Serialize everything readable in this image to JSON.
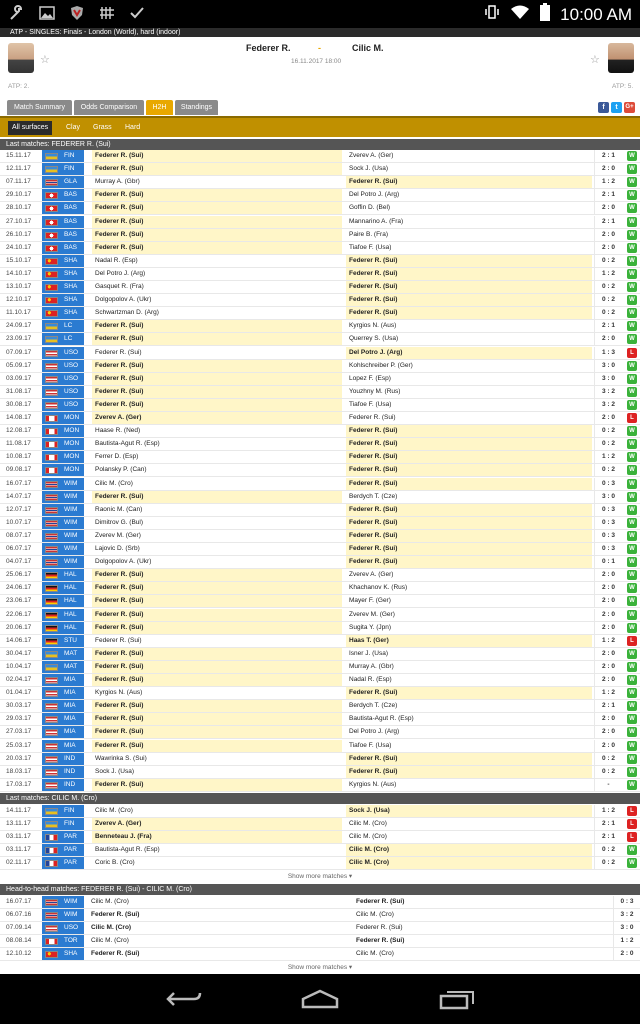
{
  "status_bar": {
    "time": "10:00 AM",
    "icons": [
      "wrench-icon",
      "image-icon",
      "shield-icon",
      "grid-icon",
      "check-icon"
    ]
  },
  "competition": "ATP - SINGLES: Finals - London (World), hard (indoor)",
  "match": {
    "home": "Federer R.",
    "away": "Cilic M.",
    "separator": "-",
    "datetime": "16.11.2017 18:00",
    "home_rank": "ATP: 2.",
    "away_rank": "ATP: 5."
  },
  "tabs": [
    "Match Summary",
    "Odds Comparison",
    "H2H",
    "Standings"
  ],
  "active_tab": "H2H",
  "social": [
    "f",
    "t",
    "G+"
  ],
  "surfaces": [
    "All surfaces",
    "Clay",
    "Grass",
    "Hard"
  ],
  "sections": {
    "federer_title": "Last matches: FEDERER R. (Sui)",
    "cilic_title": "Last matches: CILIC M. (Cro)",
    "h2h_title": "Head-to-head matches: FEDERER R. (Sui) - CILIC M. (Cro)",
    "show_more": "Show more matches"
  },
  "colors": {
    "accent": "#e8a800",
    "win": "#3ab23a",
    "loss": "#dd2222",
    "tournament": "#2b7bd1"
  },
  "federer_matches": [
    {
      "date": "15.11.17",
      "t": "FIN",
      "flag": "wld",
      "home": "Federer R. (Sui)",
      "away": "Zverev A. (Ger)",
      "score": "2 : 1",
      "res": "W",
      "f": "h"
    },
    {
      "date": "12.11.17",
      "t": "FIN",
      "flag": "wld",
      "home": "Federer R. (Sui)",
      "away": "Sock J. (Usa)",
      "score": "2 : 0",
      "res": "W",
      "f": "h"
    },
    {
      "date": "07.11.17",
      "t": "GLA",
      "flag": "gbr",
      "home": "Murray A. (Gbr)",
      "away": "Federer R. (Sui)",
      "score": "1 : 2",
      "res": "W",
      "f": "a"
    },
    {
      "date": "29.10.17",
      "t": "BAS",
      "flag": "sui",
      "home": "Federer R. (Sui)",
      "away": "Del Potro J. (Arg)",
      "score": "2 : 1",
      "res": "W",
      "f": "h"
    },
    {
      "date": "28.10.17",
      "t": "BAS",
      "flag": "sui",
      "home": "Federer R. (Sui)",
      "away": "Goffin D. (Bel)",
      "score": "2 : 0",
      "res": "W",
      "f": "h"
    },
    {
      "date": "27.10.17",
      "t": "BAS",
      "flag": "sui",
      "home": "Federer R. (Sui)",
      "away": "Mannarino A. (Fra)",
      "score": "2 : 1",
      "res": "W",
      "f": "h"
    },
    {
      "date": "26.10.17",
      "t": "BAS",
      "flag": "sui",
      "home": "Federer R. (Sui)",
      "away": "Paire B. (Fra)",
      "score": "2 : 0",
      "res": "W",
      "f": "h"
    },
    {
      "date": "24.10.17",
      "t": "BAS",
      "flag": "sui",
      "home": "Federer R. (Sui)",
      "away": "Tiafoe F. (Usa)",
      "score": "2 : 0",
      "res": "W",
      "f": "h"
    },
    {
      "date": "15.10.17",
      "t": "SHA",
      "flag": "chn",
      "home": "Nadal R. (Esp)",
      "away": "Federer R. (Sui)",
      "score": "0 : 2",
      "res": "W",
      "f": "a"
    },
    {
      "date": "14.10.17",
      "t": "SHA",
      "flag": "chn",
      "home": "Del Potro J. (Arg)",
      "away": "Federer R. (Sui)",
      "score": "1 : 2",
      "res": "W",
      "f": "a"
    },
    {
      "date": "13.10.17",
      "t": "SHA",
      "flag": "chn",
      "home": "Gasquet R. (Fra)",
      "away": "Federer R. (Sui)",
      "score": "0 : 2",
      "res": "W",
      "f": "a"
    },
    {
      "date": "12.10.17",
      "t": "SHA",
      "flag": "chn",
      "home": "Dolgopolov A. (Ukr)",
      "away": "Federer R. (Sui)",
      "score": "0 : 2",
      "res": "W",
      "f": "a"
    },
    {
      "date": "11.10.17",
      "t": "SHA",
      "flag": "chn",
      "home": "Schwartzman D. (Arg)",
      "away": "Federer R. (Sui)",
      "score": "0 : 2",
      "res": "W",
      "f": "a"
    },
    {
      "date": "24.09.17",
      "t": "LC",
      "flag": "wld",
      "home": "Federer R. (Sui)",
      "away": "Kyrgios N. (Aus)",
      "score": "2 : 1",
      "res": "W",
      "f": "h"
    },
    {
      "date": "23.09.17",
      "t": "LC",
      "flag": "wld",
      "home": "Federer R. (Sui)",
      "away": "Querrey S. (Usa)",
      "score": "2 : 0",
      "res": "W",
      "f": "h"
    },
    {
      "date": "07.09.17",
      "t": "USO",
      "flag": "usa",
      "home": "Federer R. (Sui)",
      "away": "Del Potro J. (Arg)",
      "score": "1 : 3",
      "res": "L",
      "f": "a"
    },
    {
      "date": "05.09.17",
      "t": "USO",
      "flag": "usa",
      "home": "Federer R. (Sui)",
      "away": "Kohlschreiber P. (Ger)",
      "score": "3 : 0",
      "res": "W",
      "f": "h"
    },
    {
      "date": "03.09.17",
      "t": "USO",
      "flag": "usa",
      "home": "Federer R. (Sui)",
      "away": "Lopez F. (Esp)",
      "score": "3 : 0",
      "res": "W",
      "f": "h"
    },
    {
      "date": "31.08.17",
      "t": "USO",
      "flag": "usa",
      "home": "Federer R. (Sui)",
      "away": "Youzhny M. (Rus)",
      "score": "3 : 2",
      "res": "W",
      "f": "h"
    },
    {
      "date": "30.08.17",
      "t": "USO",
      "flag": "usa",
      "home": "Federer R. (Sui)",
      "away": "Tiafoe F. (Usa)",
      "score": "3 : 2",
      "res": "W",
      "f": "h"
    },
    {
      "date": "14.08.17",
      "t": "MON",
      "flag": "can",
      "home": "Zverev A. (Ger)",
      "away": "Federer R. (Sui)",
      "score": "2 : 0",
      "res": "L",
      "f": "h"
    },
    {
      "date": "12.08.17",
      "t": "MON",
      "flag": "can",
      "home": "Haase R. (Ned)",
      "away": "Federer R. (Sui)",
      "score": "0 : 2",
      "res": "W",
      "f": "a"
    },
    {
      "date": "11.08.17",
      "t": "MON",
      "flag": "can",
      "home": "Bautista-Agut R. (Esp)",
      "away": "Federer R. (Sui)",
      "score": "0 : 2",
      "res": "W",
      "f": "a"
    },
    {
      "date": "10.08.17",
      "t": "MON",
      "flag": "can",
      "home": "Ferrer D. (Esp)",
      "away": "Federer R. (Sui)",
      "score": "1 : 2",
      "res": "W",
      "f": "a"
    },
    {
      "date": "09.08.17",
      "t": "MON",
      "flag": "can",
      "home": "Polansky P. (Can)",
      "away": "Federer R. (Sui)",
      "score": "0 : 2",
      "res": "W",
      "f": "a"
    },
    {
      "date": "16.07.17",
      "t": "WIM",
      "flag": "gbr",
      "home": "Cilic M. (Cro)",
      "away": "Federer R. (Sui)",
      "score": "0 : 3",
      "res": "W",
      "f": "a"
    },
    {
      "date": "14.07.17",
      "t": "WIM",
      "flag": "gbr",
      "home": "Federer R. (Sui)",
      "away": "Berdych T. (Cze)",
      "score": "3 : 0",
      "res": "W",
      "f": "h"
    },
    {
      "date": "12.07.17",
      "t": "WIM",
      "flag": "gbr",
      "home": "Raonic M. (Can)",
      "away": "Federer R. (Sui)",
      "score": "0 : 3",
      "res": "W",
      "f": "a"
    },
    {
      "date": "10.07.17",
      "t": "WIM",
      "flag": "gbr",
      "home": "Dimitrov G. (Bul)",
      "away": "Federer R. (Sui)",
      "score": "0 : 3",
      "res": "W",
      "f": "a"
    },
    {
      "date": "08.07.17",
      "t": "WIM",
      "flag": "gbr",
      "home": "Zverev M. (Ger)",
      "away": "Federer R. (Sui)",
      "score": "0 : 3",
      "res": "W",
      "f": "a"
    },
    {
      "date": "06.07.17",
      "t": "WIM",
      "flag": "gbr",
      "home": "Lajovic D. (Srb)",
      "away": "Federer R. (Sui)",
      "score": "0 : 3",
      "res": "W",
      "f": "a"
    },
    {
      "date": "04.07.17",
      "t": "WIM",
      "flag": "gbr",
      "home": "Dolgopolov A. (Ukr)",
      "away": "Federer R. (Sui)",
      "score": "0 : 1",
      "res": "W",
      "f": "a"
    },
    {
      "date": "25.06.17",
      "t": "HAL",
      "flag": "ger",
      "home": "Federer R. (Sui)",
      "away": "Zverev A. (Ger)",
      "score": "2 : 0",
      "res": "W",
      "f": "h"
    },
    {
      "date": "24.06.17",
      "t": "HAL",
      "flag": "ger",
      "home": "Federer R. (Sui)",
      "away": "Khachanov K. (Rus)",
      "score": "2 : 0",
      "res": "W",
      "f": "h"
    },
    {
      "date": "23.06.17",
      "t": "HAL",
      "flag": "ger",
      "home": "Federer R. (Sui)",
      "away": "Mayer F. (Ger)",
      "score": "2 : 0",
      "res": "W",
      "f": "h"
    },
    {
      "date": "22.06.17",
      "t": "HAL",
      "flag": "ger",
      "home": "Federer R. (Sui)",
      "away": "Zverev M. (Ger)",
      "score": "2 : 0",
      "res": "W",
      "f": "h"
    },
    {
      "date": "20.06.17",
      "t": "HAL",
      "flag": "ger",
      "home": "Federer R. (Sui)",
      "away": "Sugita Y. (Jpn)",
      "score": "2 : 0",
      "res": "W",
      "f": "h"
    },
    {
      "date": "14.06.17",
      "t": "STU",
      "flag": "ger",
      "home": "Federer R. (Sui)",
      "away": "Haas T. (Ger)",
      "score": "1 : 2",
      "res": "L",
      "f": "a"
    },
    {
      "date": "30.04.17",
      "t": "MAT",
      "flag": "wld",
      "home": "Federer R. (Sui)",
      "away": "Isner J. (Usa)",
      "score": "2 : 0",
      "res": "W",
      "f": "h"
    },
    {
      "date": "10.04.17",
      "t": "MAT",
      "flag": "wld",
      "home": "Federer R. (Sui)",
      "away": "Murray A. (Gbr)",
      "score": "2 : 0",
      "res": "W",
      "f": "h"
    },
    {
      "date": "02.04.17",
      "t": "MIA",
      "flag": "usa",
      "home": "Federer R. (Sui)",
      "away": "Nadal R. (Esp)",
      "score": "2 : 0",
      "res": "W",
      "f": "h"
    },
    {
      "date": "01.04.17",
      "t": "MIA",
      "flag": "usa",
      "home": "Kyrgios N. (Aus)",
      "away": "Federer R. (Sui)",
      "score": "1 : 2",
      "res": "W",
      "f": "a"
    },
    {
      "date": "30.03.17",
      "t": "MIA",
      "flag": "usa",
      "home": "Federer R. (Sui)",
      "away": "Berdych T. (Cze)",
      "score": "2 : 1",
      "res": "W",
      "f": "h"
    },
    {
      "date": "29.03.17",
      "t": "MIA",
      "flag": "usa",
      "home": "Federer R. (Sui)",
      "away": "Bautista-Agut R. (Esp)",
      "score": "2 : 0",
      "res": "W",
      "f": "h"
    },
    {
      "date": "27.03.17",
      "t": "MIA",
      "flag": "usa",
      "home": "Federer R. (Sui)",
      "away": "Del Potro J. (Arg)",
      "score": "2 : 0",
      "res": "W",
      "f": "h"
    },
    {
      "date": "25.03.17",
      "t": "MIA",
      "flag": "usa",
      "home": "Federer R. (Sui)",
      "away": "Tiafoe F. (Usa)",
      "score": "2 : 0",
      "res": "W",
      "f": "h"
    },
    {
      "date": "20.03.17",
      "t": "IND",
      "flag": "usa",
      "home": "Wawrinka S. (Sui)",
      "away": "Federer R. (Sui)",
      "score": "0 : 2",
      "res": "W",
      "f": "a"
    },
    {
      "date": "18.03.17",
      "t": "IND",
      "flag": "usa",
      "home": "Sock J. (Usa)",
      "away": "Federer R. (Sui)",
      "score": "0 : 2",
      "res": "W",
      "f": "a"
    },
    {
      "date": "17.03.17",
      "t": "IND",
      "flag": "usa",
      "home": "Federer R. (Sui)",
      "away": "Kyrgios N. (Aus)",
      "score": "-",
      "res": "W",
      "f": "h"
    }
  ],
  "cilic_matches": [
    {
      "date": "14.11.17",
      "t": "FIN",
      "flag": "wld",
      "home": "Cilic M. (Cro)",
      "away": "Sock J. (Usa)",
      "score": "1 : 2",
      "res": "L",
      "f": "a"
    },
    {
      "date": "13.11.17",
      "t": "FIN",
      "flag": "wld",
      "home": "Zverev A. (Ger)",
      "away": "Cilic M. (Cro)",
      "score": "2 : 1",
      "res": "L",
      "f": "h"
    },
    {
      "date": "03.11.17",
      "t": "PAR",
      "flag": "fra",
      "home": "Benneteau J. (Fra)",
      "away": "Cilic M. (Cro)",
      "score": "2 : 1",
      "res": "L",
      "f": "h"
    },
    {
      "date": "03.11.17",
      "t": "PAR",
      "flag": "fra",
      "home": "Bautista-Agut R. (Esp)",
      "away": "Cilic M. (Cro)",
      "score": "0 : 2",
      "res": "W",
      "f": "a"
    },
    {
      "date": "02.11.17",
      "t": "PAR",
      "flag": "fra",
      "home": "Coric B. (Cro)",
      "away": "Cilic M. (Cro)",
      "score": "0 : 2",
      "res": "W",
      "f": "a"
    }
  ],
  "h2h_matches": [
    {
      "date": "16.07.17",
      "t": "WIM",
      "flag": "gbr",
      "home": "Cilic M. (Cro)",
      "away": "Federer R. (Sui)",
      "score": "0 : 3",
      "f": "a"
    },
    {
      "date": "06.07.16",
      "t": "WIM",
      "flag": "gbr",
      "home": "Federer R. (Sui)",
      "away": "Cilic M. (Cro)",
      "score": "3 : 2",
      "f": "h"
    },
    {
      "date": "07.09.14",
      "t": "USO",
      "flag": "usa",
      "home": "Cilic M. (Cro)",
      "away": "Federer R. (Sui)",
      "score": "3 : 0",
      "f": "h"
    },
    {
      "date": "08.08.14",
      "t": "TOR",
      "flag": "can",
      "home": "Cilic M. (Cro)",
      "away": "Federer R. (Sui)",
      "score": "1 : 2",
      "f": "a"
    },
    {
      "date": "12.10.12",
      "t": "SHA",
      "flag": "chn",
      "home": "Federer R. (Sui)",
      "away": "Cilic M. (Cro)",
      "score": "2 : 0",
      "f": "h"
    }
  ]
}
